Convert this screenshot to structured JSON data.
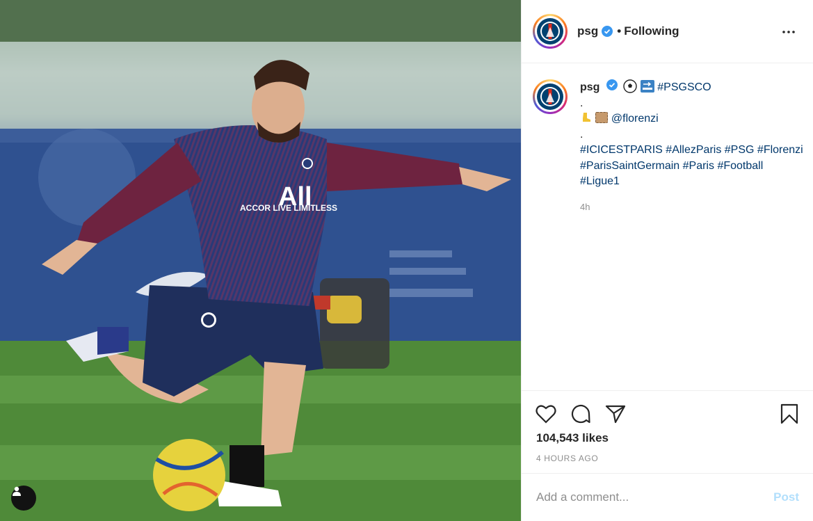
{
  "post": {
    "username": "psg",
    "follow_separator": "•",
    "follow_status": "Following",
    "more_label": "•••",
    "caption": {
      "username": "psg",
      "line1_tag": "#PSGSCO",
      "line2": ".",
      "mention": "@florenzi",
      "line4": ".",
      "tags": [
        "#ICICESTPARIS",
        "#AllezParis",
        "#PSG",
        "#Florenzi",
        "#ParisSaintGermain",
        "#Paris",
        "#Football",
        "#Ligue1"
      ],
      "emojis": [
        "soccer-ball",
        "soon-arrow",
        "cleat",
        "biscuit"
      ]
    },
    "relative_time": "4h",
    "likes": "104,543 likes",
    "timestamp": "4 HOURS AGO"
  },
  "comment": {
    "placeholder": "Add a comment...",
    "post_label": "Post"
  },
  "icons": [
    "verified-icon",
    "more-options-icon",
    "heart-icon",
    "comment-icon",
    "share-icon",
    "save-icon",
    "user-tag-icon"
  ],
  "colors": {
    "verified_blue": "#3897f0",
    "link_blue": "#00376b",
    "post_button": "#b2dffc",
    "secondary_text": "#8e8e8e",
    "psg_navy": "#004170",
    "psg_red": "#da291c"
  }
}
